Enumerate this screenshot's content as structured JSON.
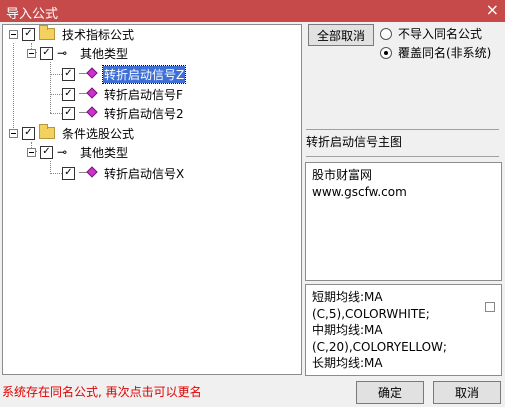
{
  "window": {
    "title": "导入公式",
    "close_glyph": "×"
  },
  "tree": {
    "groups": [
      {
        "label": "技术指标公式",
        "checked": true,
        "sub": {
          "label": "其他类型",
          "checked": true,
          "items": [
            {
              "label": "转折启动信号Z",
              "checked": true,
              "selected": true
            },
            {
              "label": "转折启动信号F",
              "checked": true
            },
            {
              "label": "转折启动信号2",
              "checked": true
            }
          ]
        }
      },
      {
        "label": "条件选股公式",
        "checked": true,
        "sub": {
          "label": "其他类型",
          "checked": true,
          "items": [
            {
              "label": "转折启动信号X",
              "checked": true
            }
          ]
        }
      }
    ]
  },
  "right": {
    "deselect_all_label": "全部取消",
    "radio_no_import": "不导入同名公式",
    "radio_overwrite": "覆盖同名(非系统)",
    "overwrite_selected": true,
    "formula_name": "转折启动信号主图",
    "description_lines": [
      "股市财富网",
      "www.gscfw.com"
    ],
    "source_lines": [
      "短期均线:MA",
      "(C,5),COLORWHITE;",
      "中期均线:MA",
      "(C,20),COLORYELLOW;",
      "长期均线:MA"
    ]
  },
  "footer": {
    "status": "系统存在同名公式, 再次点击可以更名",
    "ok_label": "确定",
    "cancel_label": "取消"
  },
  "colors": {
    "titlebar": "#c74a4a",
    "selection": "#3d6fd6",
    "status_text": "#e00000",
    "item_icon": "#cc33cc",
    "folder": "#f2d15e"
  }
}
